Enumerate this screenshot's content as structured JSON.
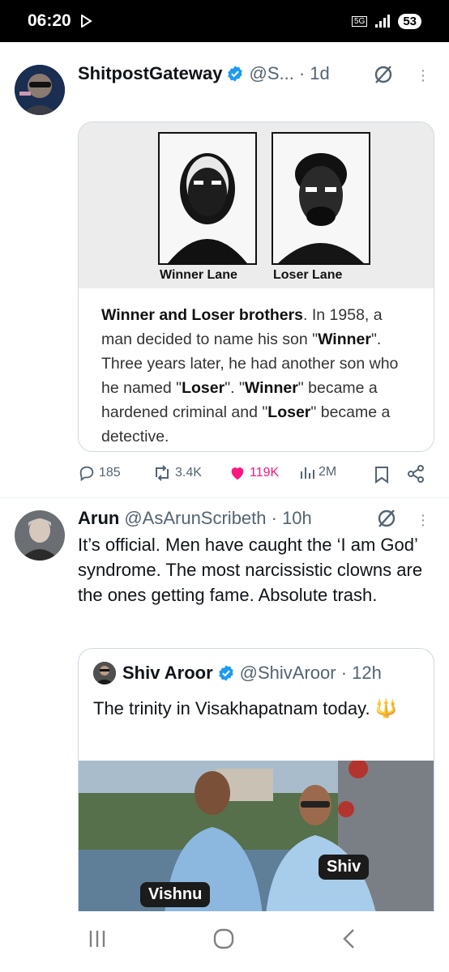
{
  "status_bar": {
    "time": "06:20",
    "network": "5G",
    "battery": "53"
  },
  "tweet1": {
    "name": "ShitpostGateway",
    "handle": "@S...",
    "time": "· 1d",
    "card": {
      "left_caption": "Winner Lane",
      "right_caption": "Loser Lane",
      "text_title": "Winner and Loser brothers",
      "text_1": ". In 1958, a man decided to name his son \"",
      "w1": "Winner",
      "text_2": "\". Three years later, he had another son who he named \"",
      "l1": "Loser",
      "text_3": "\". \"",
      "w2": "Winner",
      "text_4": "\" became a hardened criminal and \"",
      "l2": "Loser",
      "text_5": "\" became a detective."
    },
    "stats": {
      "replies": "185",
      "reposts": "3.4K",
      "likes": "119K",
      "views": "2M"
    },
    "colors": {
      "like": "#f91880",
      "verified": "#1d9bf0"
    }
  },
  "tweet2": {
    "name": "Arun",
    "handle": "@AsArunScribeth · 10h",
    "text": "It’s official. Men have caught the ‘I am God’ syndrome. The most narcissistic clowns are the ones getting fame. Absolute trash.",
    "quote": {
      "name": "Shiv Aroor",
      "handle": "@ShivAroor · 12h",
      "text": "The trinity in Visakhapatnam today. 🔱",
      "tag_left": "Vishnu",
      "tag_right": "Shiv"
    }
  },
  "nav": {
    "icons": [
      "recent-apps-icon",
      "home-icon",
      "back-icon"
    ]
  }
}
